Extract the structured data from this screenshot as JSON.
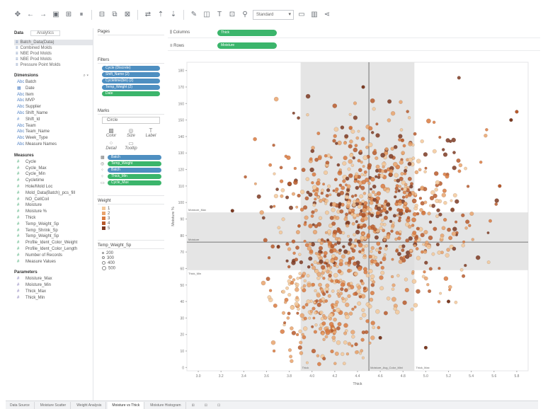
{
  "toolbar": {
    "buttons": [
      "undo-icon",
      "redo-icon",
      "back-icon",
      "save-icon",
      "new-datasource-icon",
      "pause-icon",
      "swap-icon",
      "sort-asc-icon",
      "sort-desc-icon",
      "highlight-icon",
      "group-icon",
      "label-icon",
      "fix-axes-icon",
      "presentation-icon",
      "share-icon"
    ],
    "fit_select": "Standard"
  },
  "data_pane": {
    "tab_data": "Data",
    "tab_analytics": "Analytics",
    "datasources": [
      "Batch_Data(Data)",
      "Combined Molds",
      "NBE Prod Molds",
      "NBE Prod Molds",
      "Pressure Point Molds"
    ],
    "dimensions_title": "Dimensions",
    "dimensions": [
      "Batch",
      "Date",
      "Item",
      "MVP",
      "Supplier",
      "Shift_Name",
      "Shift_Id",
      "Team",
      "Team_Name",
      "Week_Type",
      "Measure Names"
    ],
    "measures_title": "Measures",
    "measures": [
      "Cycle",
      "Cycle_Max",
      "Cycle_Min",
      "Cycletime",
      "Hole/Mold Loc",
      "Mold_Data(Batch)_pcs_fill",
      "NO_CellCoil",
      "Moisture",
      "Moisture %",
      "Thick",
      "Temp_Weight_Sp",
      "Temp_Shrink_Sp",
      "Temp_Weight_Sp",
      "Profile_Ident_Color_Weight",
      "Profile_Ident_Color_Length",
      "Number of Records",
      "Measure Values"
    ],
    "parameters_title": "Parameters",
    "parameters": [
      "Moisture_Max",
      "Moisture_Min",
      "Thick_Max",
      "Thick_Min"
    ]
  },
  "shelves": {
    "pages_title": "Pages",
    "filters_title": "Filters",
    "filters": [
      "Cycle (Discrete)",
      "Shift_Name (2)",
      "Cycletime(bin) (2)",
      "Temp_Weight (2)",
      "Date"
    ],
    "marks_title": "Marks",
    "mark_type": "Circle",
    "mark_buttons": [
      "Color",
      "Size",
      "Label",
      "Detail",
      "Tooltip"
    ],
    "mark_pills": [
      "Batch",
      "Temp_Weight",
      "Batch",
      "Thick_Min",
      "Cycle_Max"
    ],
    "color_legend_title": "Weight",
    "color_legend": [
      "1",
      "2",
      "3",
      "4",
      "5"
    ],
    "size_legend_title": "Temp_Weight_Sp",
    "size_legend": [
      "200",
      "300",
      "400",
      "500"
    ],
    "columns_label": "Columns",
    "rows_label": "Rows",
    "columns_pill": "Thick",
    "rows_pill": "Moisture"
  },
  "chart_data": {
    "type": "scatter",
    "xlabel": "Thick",
    "ylabel": "Moisture %",
    "x_ticks": [
      "3.0",
      "3.2",
      "3.4",
      "3.6",
      "3.8",
      "4.0",
      "4.2",
      "4.4",
      "4.6",
      "4.8",
      "5.0",
      "5.2",
      "5.4",
      "5.6",
      "5.8"
    ],
    "y_ticks": [
      "180",
      "170",
      "160",
      "150",
      "140",
      "130",
      "120",
      "110",
      "100",
      "90",
      "80",
      "70",
      "60",
      "50",
      "40",
      "30",
      "20",
      "10",
      "0"
    ],
    "xlim": [
      2.9,
      5.9
    ],
    "ylim": [
      -2,
      185
    ],
    "reference_bands": {
      "x_band": [
        3.9,
        4.9
      ],
      "y_band": [
        59,
        94
      ]
    },
    "reference_labels": [
      "Moisture_Max",
      "Moisture",
      "Thick_Min",
      "Thick",
      "Moisture_Avg_Color_Mini",
      "Thick_Max"
    ],
    "colors": [
      "#f3c99b",
      "#e9a36c",
      "#d97a40",
      "#b85a2c",
      "#7c3a22"
    ]
  },
  "bottom_tabs": [
    "Data Source",
    "Moisture Scatter",
    "Weight Analysis",
    "Moisture vs Thick",
    "Moisture Histogram"
  ]
}
